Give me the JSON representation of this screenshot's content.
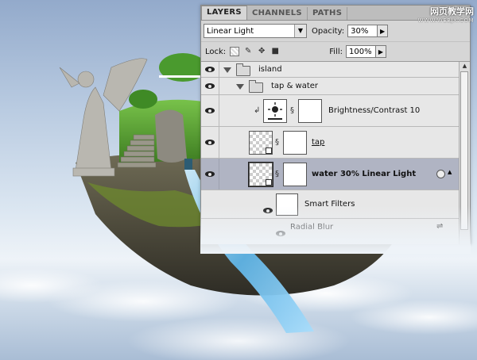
{
  "watermark": {
    "line1": "网页教学网",
    "line2": "WWW.WEBJX.COM"
  },
  "panel": {
    "tabs": [
      {
        "label": "LAYERS",
        "active": true
      },
      {
        "label": "CHANNELS",
        "active": false
      },
      {
        "label": "PATHS",
        "active": false
      }
    ],
    "blend_mode": "Linear Light",
    "opacity_label": "Opacity:",
    "opacity_value": "30%",
    "lock_label": "Lock:",
    "fill_label": "Fill:",
    "fill_value": "100%",
    "layers": [
      {
        "name": "island",
        "type": "group"
      },
      {
        "name": "tap & water",
        "type": "group"
      },
      {
        "name": "Brightness/Contrast 10",
        "type": "adjustment"
      },
      {
        "name": "tap",
        "type": "smart-object"
      },
      {
        "name": "water 30% Linear Light",
        "type": "smart-object",
        "selected": true
      },
      {
        "name": "Smart Filters",
        "type": "smart-filters"
      },
      {
        "name": "Radial Blur",
        "type": "filter"
      }
    ]
  },
  "colors": {
    "panel_bg": "#d6d6d6",
    "selected_row": "#b0b4c3",
    "water": "#5fb4e6",
    "grass": "#4d9b2c"
  }
}
